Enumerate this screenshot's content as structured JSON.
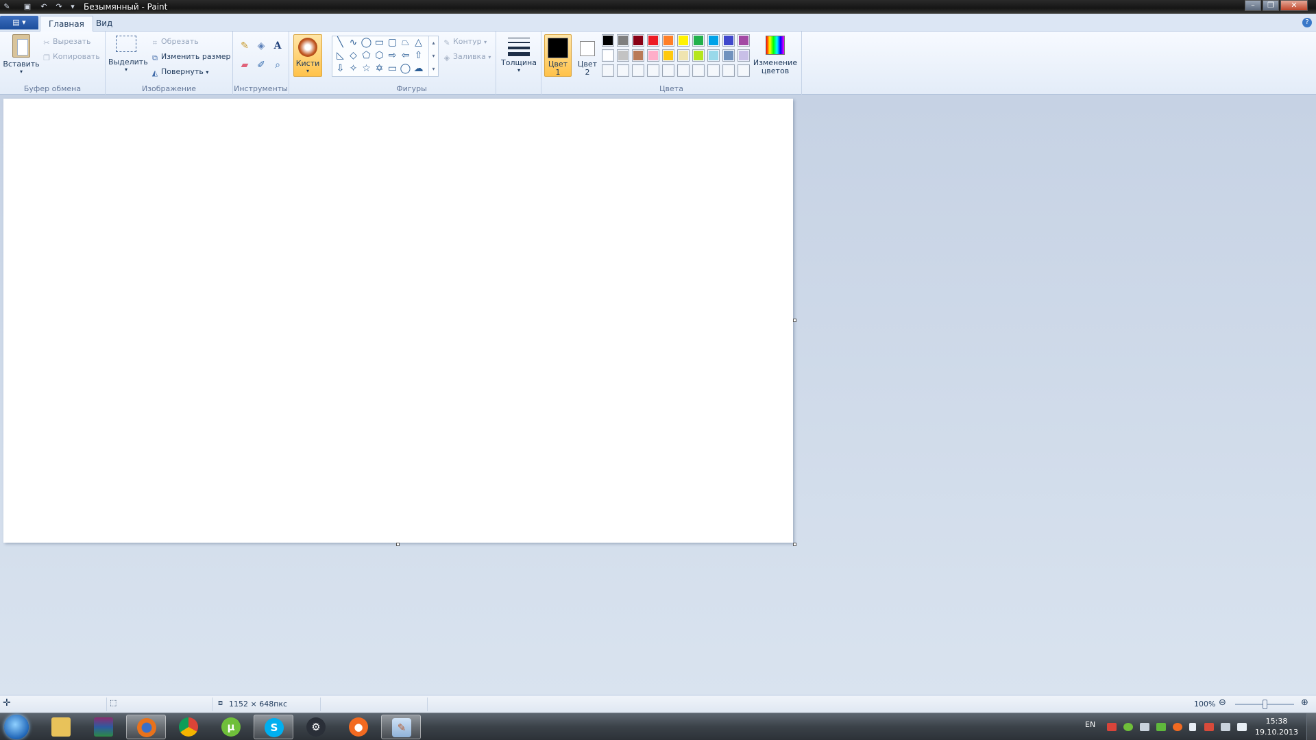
{
  "window": {
    "title": "Безымянный - Paint"
  },
  "tabs": {
    "home": "Главная",
    "view": "Вид"
  },
  "clipboard": {
    "paste": "Вставить",
    "cut": "Вырезать",
    "copy": "Копировать",
    "group": "Буфер обмена"
  },
  "image": {
    "select": "Выделить",
    "crop": "Обрезать",
    "resize": "Изменить размер",
    "rotate": "Повернуть",
    "group": "Изображение"
  },
  "tools": {
    "group": "Инструменты"
  },
  "brushes": {
    "label": "Кисти"
  },
  "shapes": {
    "outline": "Контур",
    "fill": "Заливка",
    "group": "Фигуры"
  },
  "size": {
    "label": "Толщина"
  },
  "colors": {
    "color1_a": "Цвет",
    "color1_b": "1",
    "color2_a": "Цвет",
    "color2_b": "2",
    "edit_a": "Изменение",
    "edit_b": "цветов",
    "group": "Цвета",
    "palette_row1": [
      "#000000",
      "#7f7f7f",
      "#880015",
      "#ed1c24",
      "#ff7f27",
      "#fff200",
      "#22b14c",
      "#00a2e8",
      "#3f48cc",
      "#a349a4"
    ],
    "palette_row2": [
      "#ffffff",
      "#c3c3c3",
      "#b97a57",
      "#ffaec9",
      "#ffc90e",
      "#efe4b0",
      "#b5e61d",
      "#99d9ea",
      "#7092be",
      "#c8bfe7"
    ],
    "current1": "#000000",
    "current2": "#ffffff"
  },
  "status": {
    "dimensions": "1152 × 648пкс",
    "zoom": "100%"
  },
  "taskbar": {
    "lang": "EN",
    "time": "15:38",
    "date": "19.10.2013"
  }
}
